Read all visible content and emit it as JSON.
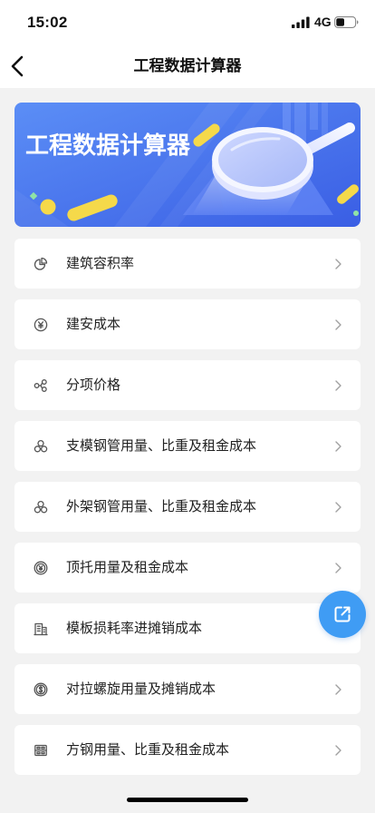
{
  "status_bar": {
    "time": "15:02",
    "network": "4G",
    "battery_level": 0.45
  },
  "nav": {
    "title": "工程数据计算器",
    "back_icon": "chevron-left-icon"
  },
  "banner": {
    "title": "工程数据计算器"
  },
  "list": {
    "items": [
      {
        "label": "建筑容积率",
        "icon": "pie-chart-icon"
      },
      {
        "label": "建安成本",
        "icon": "yen-circle-icon"
      },
      {
        "label": "分项价格",
        "icon": "share-nodes-icon"
      },
      {
        "label": "支模钢管用量、比重及租金成本",
        "icon": "three-circles-icon"
      },
      {
        "label": "外架钢管用量、比重及租金成本",
        "icon": "three-circles-icon"
      },
      {
        "label": "顶托用量及租金成本",
        "icon": "yen-badge-icon"
      },
      {
        "label": "模板损耗率进摊销成本",
        "icon": "building-icon"
      },
      {
        "label": "对拉螺旋用量及摊销成本",
        "icon": "dollar-circle-icon"
      },
      {
        "label": "方钢用量、比重及租金成本",
        "icon": "cabinet-icon"
      }
    ],
    "chevron_icon": "chevron-right-icon"
  },
  "fab": {
    "icon": "external-link-icon"
  },
  "colors": {
    "background": "#f2f2f2",
    "header": "#ffffff",
    "card": "#ffffff",
    "text": "#222222",
    "icon": "#555555",
    "chevron": "#a0a0a0",
    "banner_start": "#5b8ef6",
    "banner_end": "#3a5ee4",
    "fab": "#3f9cf4",
    "accent_yellow": "#f5d94a",
    "accent_green": "#8fe3a6"
  }
}
